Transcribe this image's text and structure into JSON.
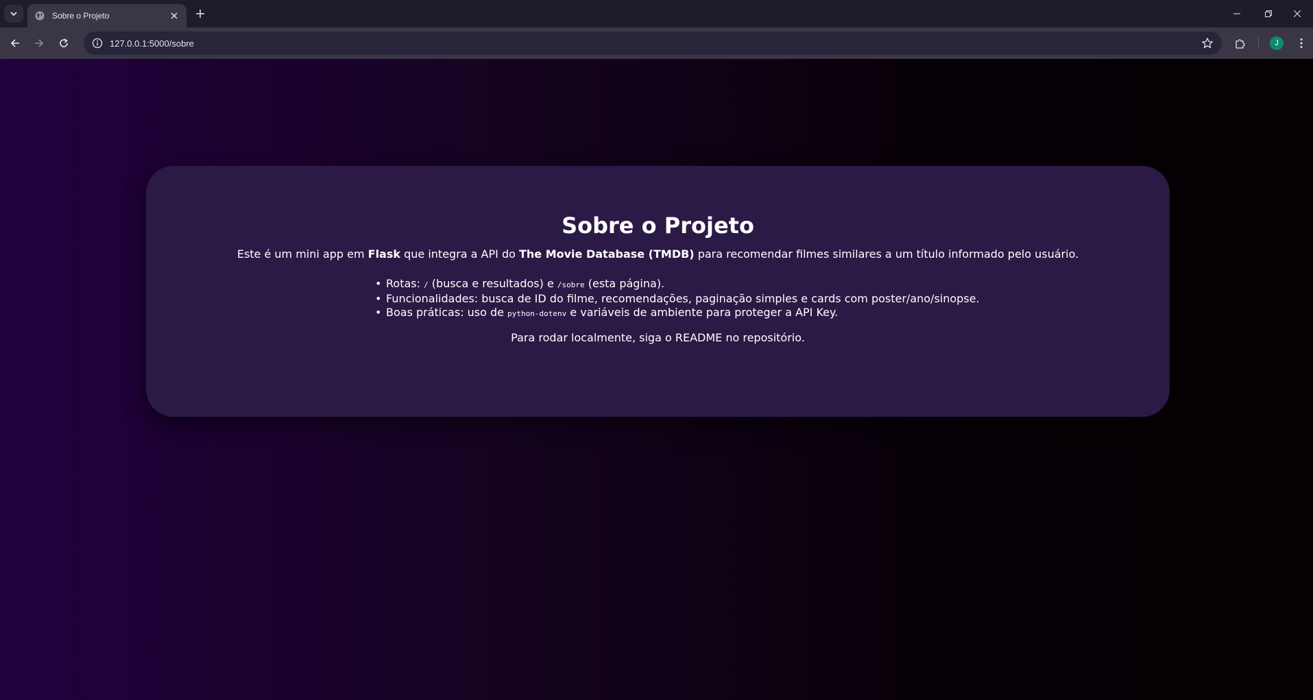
{
  "browser": {
    "tab_title": "Sobre o Projeto",
    "url": "127.0.0.1:5000/sobre",
    "avatar_letter": "J",
    "accent_color": "#0f8a6f"
  },
  "page": {
    "heading": "Sobre o Projeto",
    "intro": {
      "prefix": "Este é um mini app em ",
      "flask": "Flask",
      "middle": " que integra a API do ",
      "tmdb": "The Movie Database (TMDB)",
      "suffix": " para recomendar filmes similares a um título informado pelo usuário."
    },
    "features": {
      "rotas_label": "Rotas: ",
      "rotas_code1": "/",
      "rotas_mid": " (busca e resultados) e ",
      "rotas_code2": "/sobre",
      "rotas_end": " (esta página).",
      "funcionalidades": "Funcionalidades: busca de ID do filme, recomendações, paginação simples e cards com poster/ano/sinopse.",
      "boas_label": "Boas práticas: uso de ",
      "boas_code": "python-dotenv",
      "boas_end": " e variáveis de ambiente para proteger a API Key."
    },
    "footer_note": "Para rodar localmente, siga o README no repositório."
  }
}
